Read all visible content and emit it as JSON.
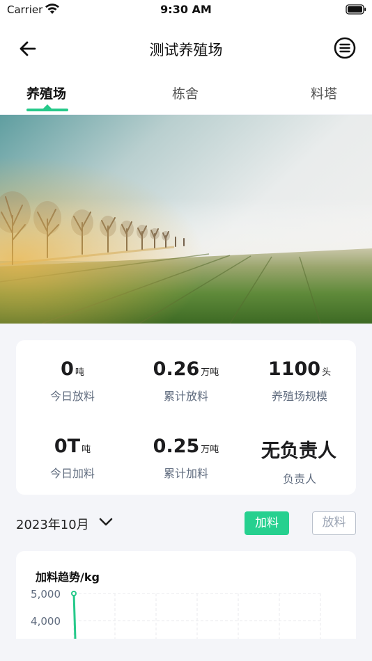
{
  "status_bar": {
    "carrier": "Carrier",
    "time": "9:30 AM"
  },
  "header": {
    "title": "测试养殖场"
  },
  "tabs": [
    {
      "label": "养殖场",
      "active": true
    },
    {
      "label": "栋舍",
      "active": false
    },
    {
      "label": "料塔",
      "active": false
    }
  ],
  "stats": [
    {
      "value": "0",
      "unit": "吨",
      "label": "今日放料"
    },
    {
      "value": "0.26",
      "unit": "万吨",
      "label": "累计放料"
    },
    {
      "value": "1100",
      "unit": "头",
      "label": "养殖场规模"
    },
    {
      "value": "0T",
      "unit": "吨",
      "label": "今日加料"
    },
    {
      "value": "0.25",
      "unit": "万吨",
      "label": "累计加料"
    },
    {
      "value": "无负责人",
      "unit": "",
      "label": "负责人"
    }
  ],
  "filter": {
    "month": "2023年10月",
    "add_label": "加料",
    "put_label": "放料",
    "add_active": true
  },
  "colors": {
    "accent": "#26c98a",
    "button_green": "#26d08f",
    "label_gray": "#5f6b7e"
  },
  "chart_data": {
    "type": "line",
    "title": "加料趋势/kg",
    "y_ticks": [
      "5,000",
      "4,000"
    ],
    "visible_ylim": [
      4000,
      5000
    ],
    "series": [
      {
        "values": [
          5000
        ]
      }
    ],
    "grid": true
  }
}
